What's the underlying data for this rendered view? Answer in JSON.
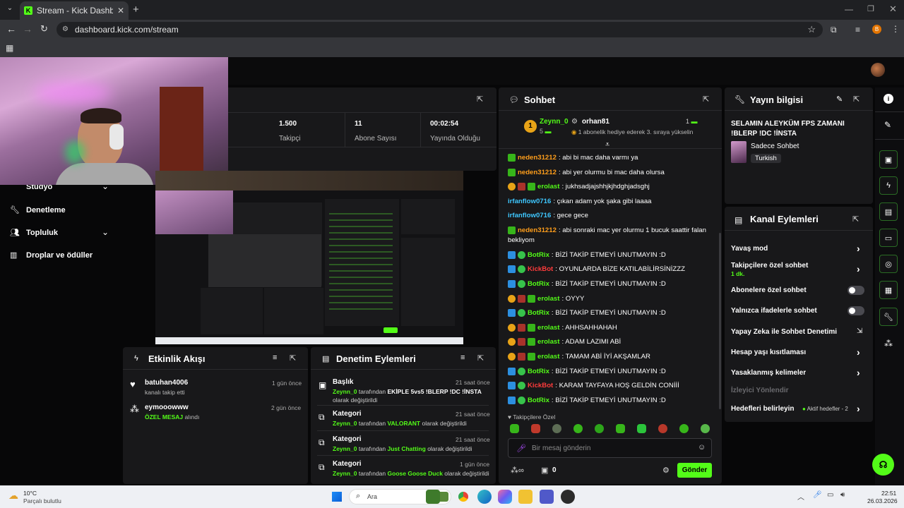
{
  "browser": {
    "tab_title": "Stream - Kick Dashboard",
    "url": "dashboard.kick.com/stream",
    "profile_initial": "B"
  },
  "stats": {
    "followers_value": "1.500",
    "followers_label": "Takipçi",
    "subs_value": "11",
    "subs_label": "Abone Sayısı",
    "uptime_value": "00:02:54",
    "uptime_label": "Yayında Olduğu"
  },
  "sidebar": {
    "items": [
      {
        "label": "Stüdyo"
      },
      {
        "label": "Denetleme"
      },
      {
        "label": "Topluluk"
      },
      {
        "label": "Droplar ve ödüller"
      }
    ]
  },
  "chat": {
    "title": "Sohbet",
    "pinned": {
      "rank": "1",
      "user1": "Zeynn_0",
      "user1_count": "5",
      "user2": "orhan81",
      "user2_count": "1",
      "message": "1 abonelik hediye ederek 3. sıraya yükselin"
    },
    "messages": [
      {
        "user": "neden31212",
        "text": ": abi bi mac daha varmı ya",
        "color": "#ff9e1b"
      },
      {
        "user": "neden31212",
        "text": ": abi yer olurmu bi mac daha olursa",
        "color": "#ff9e1b"
      },
      {
        "user": "erolast",
        "text": ": jukhsadjajshhjkjhdghjadsghj",
        "color": "#53fc18"
      },
      {
        "user": "irfanflow0716",
        "text": ": çıkan adam yok şaka gibi laaaa",
        "color": "#3ec7ff"
      },
      {
        "user": "irfanflow0716",
        "text": ": gece gece",
        "color": "#3ec7ff"
      },
      {
        "user": "neden31212",
        "text": ": abi sonraki mac yer olurmu 1 bucuk saattir falan",
        "color": "#ff9e1b"
      },
      {
        "user": "",
        "text": "bekliyom",
        "color": "#ffffff"
      },
      {
        "user": "BotRix",
        "text": ": BİZİ TAKİP ETMEYİ UNUTMAYIN :D",
        "color": "#53fc18"
      },
      {
        "user": "KickBot",
        "text": ": OYUNLARDA BİZE KATILABİLİRSİNİZZZ",
        "color": "#ff3b3b"
      },
      {
        "user": "BotRix",
        "text": ": BİZİ TAKİP ETMEYİ UNUTMAYIN :D",
        "color": "#53fc18"
      },
      {
        "user": "erolast",
        "text": ": OYYY",
        "color": "#53fc18"
      },
      {
        "user": "BotRix",
        "text": ": BİZİ TAKİP ETMEYİ UNUTMAYIN :D",
        "color": "#53fc18"
      },
      {
        "user": "erolast",
        "text": ": AHHSAHHAHAH",
        "color": "#53fc18"
      },
      {
        "user": "erolast",
        "text": ": ADAM LAZIMI ABİ",
        "color": "#53fc18"
      },
      {
        "user": "erolast",
        "text": ": TAMAM ABİ İYİ AKŞAMLAR",
        "color": "#53fc18"
      },
      {
        "user": "BotRix",
        "text": ": BİZİ TAKİP ETMEYİ UNUTMAYIN :D",
        "color": "#53fc18"
      },
      {
        "user": "KickBot",
        "text": ": KARAM TAYFAYA HOŞ GELDİN CONİİİ",
        "color": "#ff3b3b"
      },
      {
        "user": "BotRix",
        "text": ": BİZİ TAKİP ETMEYİ UNUTMAYIN :D",
        "color": "#53fc18"
      }
    ],
    "followers_only_label": "Takipçilere Özel",
    "input_placeholder": "Bir mesaj gönderin",
    "points_value": "0",
    "send_label": "Gönder"
  },
  "stream_info": {
    "title": "Yayın bilgisi",
    "stream_title": "SELAMIN ALEYKÜM FPS ZAMANI !BLERP !DC !İNSTA",
    "category": "Sadece Sohbet",
    "language": "Turkish"
  },
  "channel_actions": {
    "title": "Kanal Eylemleri",
    "items": [
      {
        "label": "Yavaş mod"
      },
      {
        "label": "Takipçilere özel sohbet",
        "sub": "1 dk."
      },
      {
        "label": "Abonelere özel sohbet"
      },
      {
        "label": "Yalnızca ifadelerle sohbet"
      },
      {
        "label": "Yapay Zeka ile Sohbet Denetimi"
      },
      {
        "label": "Hesap yaşı kısıtlaması"
      },
      {
        "label": "Yasaklanmış kelimeler"
      },
      {
        "label": "İzleyici Yönlendir"
      },
      {
        "label": "Hedefleri belirleyin",
        "sub": "Aktif hedefler - 2"
      }
    ]
  },
  "activity": {
    "title": "Etkinlik Akışı",
    "events": [
      {
        "user": "batuhan4006",
        "desc": "kanalı takip etti",
        "time": "1 gün önce"
      },
      {
        "user": "eymooowww",
        "highlight": "ÖZEL MESAJ",
        "desc": " alındı",
        "time": "2 gün önce"
      }
    ]
  },
  "mod_actions": {
    "title": "Denetim Eylemleri",
    "items": [
      {
        "title": "Başlık",
        "time": "21 saat önce",
        "user": "Zeynn_0",
        "by": " tarafından ",
        "value": "EKİPLE 5vs5 !BLERP !DC !İNSTA",
        "suffix": "olarak değiştirildi"
      },
      {
        "title": "Kategori",
        "time": "21 saat önce",
        "user": "Zeynn_0",
        "by": " tarafından ",
        "value": "VALORANT",
        "suffix": " olarak değiştirildi"
      },
      {
        "title": "Kategori",
        "time": "21 saat önce",
        "user": "Zeynn_0",
        "by": " tarafından ",
        "value": "Just Chatting",
        "suffix": " olarak değiştirildi"
      },
      {
        "title": "Kategori",
        "time": "1 gün önce",
        "user": "Zeynn_0",
        "by": " tarafından ",
        "value": "Goose Goose Duck",
        "suffix": " olarak değiştirildi"
      }
    ]
  },
  "taskbar": {
    "weather_temp": "10°C",
    "weather_desc": "Parçalı bulutlu",
    "search_label": "Ara",
    "time": "22:51",
    "date": "26.03.2026"
  },
  "colors": {
    "accent": "#53fc18",
    "panel": "#18181a",
    "background": "#070708"
  }
}
